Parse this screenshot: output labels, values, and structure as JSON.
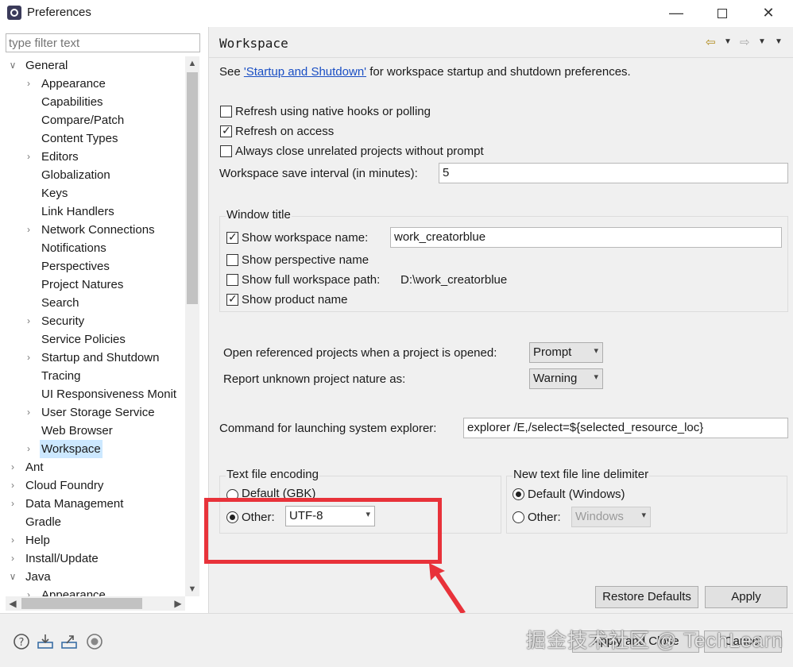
{
  "window": {
    "title": "Preferences",
    "minimize": "—",
    "close": "✕"
  },
  "left": {
    "filter_placeholder": "type filter text",
    "tree": [
      {
        "label": "General",
        "level": 0,
        "arrow": "expanded"
      },
      {
        "label": "Appearance",
        "level": 1,
        "arrow": "collapsed"
      },
      {
        "label": "Capabilities",
        "level": 1,
        "arrow": "none"
      },
      {
        "label": "Compare/Patch",
        "level": 1,
        "arrow": "none"
      },
      {
        "label": "Content Types",
        "level": 1,
        "arrow": "none"
      },
      {
        "label": "Editors",
        "level": 1,
        "arrow": "collapsed"
      },
      {
        "label": "Globalization",
        "level": 1,
        "arrow": "none"
      },
      {
        "label": "Keys",
        "level": 1,
        "arrow": "none"
      },
      {
        "label": "Link Handlers",
        "level": 1,
        "arrow": "none"
      },
      {
        "label": "Network Connections",
        "level": 1,
        "arrow": "collapsed"
      },
      {
        "label": "Notifications",
        "level": 1,
        "arrow": "none"
      },
      {
        "label": "Perspectives",
        "level": 1,
        "arrow": "none"
      },
      {
        "label": "Project Natures",
        "level": 1,
        "arrow": "none"
      },
      {
        "label": "Search",
        "level": 1,
        "arrow": "none"
      },
      {
        "label": "Security",
        "level": 1,
        "arrow": "collapsed"
      },
      {
        "label": "Service Policies",
        "level": 1,
        "arrow": "none"
      },
      {
        "label": "Startup and Shutdown",
        "level": 1,
        "arrow": "collapsed"
      },
      {
        "label": "Tracing",
        "level": 1,
        "arrow": "none"
      },
      {
        "label": "UI Responsiveness Monit",
        "level": 1,
        "arrow": "none"
      },
      {
        "label": "User Storage Service",
        "level": 1,
        "arrow": "collapsed"
      },
      {
        "label": "Web Browser",
        "level": 1,
        "arrow": "none"
      },
      {
        "label": "Workspace",
        "level": 1,
        "arrow": "collapsed",
        "selected": true
      },
      {
        "label": "Ant",
        "level": 0,
        "arrow": "collapsed"
      },
      {
        "label": "Cloud Foundry",
        "level": 0,
        "arrow": "collapsed"
      },
      {
        "label": "Data Management",
        "level": 0,
        "arrow": "collapsed"
      },
      {
        "label": "Gradle",
        "level": 0,
        "arrow": "none"
      },
      {
        "label": "Help",
        "level": 0,
        "arrow": "collapsed"
      },
      {
        "label": "Install/Update",
        "level": 0,
        "arrow": "collapsed"
      },
      {
        "label": "Java",
        "level": 0,
        "arrow": "expanded"
      },
      {
        "label": "Appearance",
        "level": 1,
        "arrow": "collapsed"
      }
    ]
  },
  "page": {
    "title": "Workspace",
    "intro_prefix": "See ",
    "intro_link": "'Startup and Shutdown'",
    "intro_suffix": " for workspace startup and shutdown preferences.",
    "refresh_native": {
      "label": "Refresh using native hooks or polling",
      "checked": false
    },
    "refresh_access": {
      "label": "Refresh on access",
      "checked": true
    },
    "always_close": {
      "label": "Always close unrelated projects without prompt",
      "checked": false
    },
    "save_interval_label": "Workspace save interval (in minutes):",
    "save_interval_value": "5",
    "window_title": {
      "group_label": "Window title",
      "show_ws_name": {
        "label": "Show workspace name:",
        "checked": true,
        "value": "work_creatorblue"
      },
      "show_perspective": {
        "label": "Show perspective name",
        "checked": false
      },
      "show_full_path": {
        "label": "Show full workspace path:",
        "checked": false,
        "value": "D:\\work_creatorblue"
      },
      "show_product": {
        "label": "Show product name",
        "checked": true
      }
    },
    "open_ref_label": "Open referenced projects when a project is opened:",
    "open_ref_value": "Prompt",
    "report_nature_label": "Report unknown project nature as:",
    "report_nature_value": "Warning",
    "explorer_label": "Command for launching system explorer:",
    "explorer_value": "explorer /E,/select=${selected_resource_loc}",
    "encoding": {
      "group_label": "Text file encoding",
      "default_label": "Default (GBK)",
      "other_label": "Other:",
      "other_value": "UTF-8",
      "selected": "other"
    },
    "delimiter": {
      "group_label": "New text file line delimiter",
      "default_label": "Default (Windows)",
      "other_label": "Other:",
      "other_value": "Windows",
      "selected": "default"
    },
    "restore_defaults": "Restore Defaults",
    "apply": "Apply"
  },
  "footer": {
    "icons": [
      "help-icon",
      "import-icon",
      "export-icon",
      "record-icon"
    ],
    "apply_close": "Apply and Close",
    "cancel": "Cancel",
    "watermark": "掘金技术社区 @ TechLearn"
  },
  "colors": {
    "highlight": "#e8323a",
    "selection": "#cce8ff",
    "link": "#1a4fc4"
  }
}
